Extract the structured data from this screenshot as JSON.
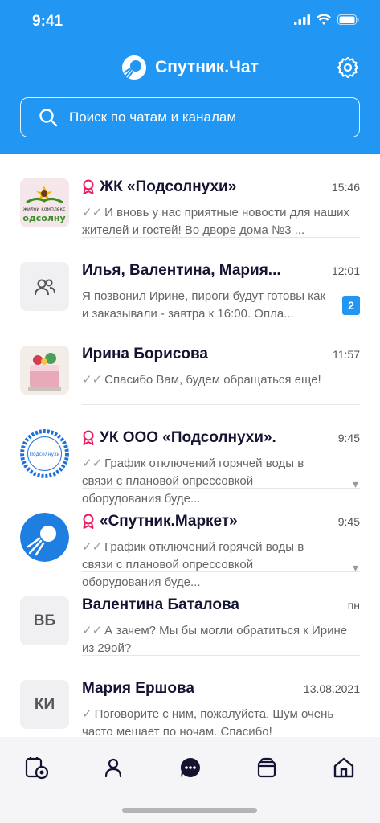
{
  "status": {
    "time": "9:41"
  },
  "header": {
    "title": "Спутник.Чат",
    "search_placeholder": "Поиск по чатам и каналам"
  },
  "chats": [
    {
      "name": "ЖК «Подсолнухи»",
      "time": "15:46",
      "message": "И вновь у нас приятные новости для наших жителей и гостей! Во дворе дома №3 ...",
      "pinned": true,
      "avatar_text": "жилой комплекс Подсолнухи"
    },
    {
      "name": "Илья, Валентина, Мария...",
      "time": "12:01",
      "message": "Я позвонил Ирине, пироги будут готовы как и заказывали - завтра к 16:00. Опла...",
      "unread": "2"
    },
    {
      "name": "Ирина Борисова",
      "time": "11:57",
      "message": "Спасибо Вам, будем обращаться еще!"
    },
    {
      "name": "УК ООО «Подсолнухи».",
      "time": "9:45",
      "message": "График отключений горячей воды в связи с плановой опрессовкой оборудования буде...",
      "pinned": true,
      "avatar_text": "Подсолнухи"
    },
    {
      "name": "«Спутник.Маркет»",
      "time": "9:45",
      "message": "График отключений горячей воды в связи с плановой опрессовкой оборудования буде...",
      "pinned": true
    },
    {
      "name": "Валентина Баталова",
      "time": "пн",
      "message": "А зачем? Мы бы могли обратиться к Ирине из 29ой?",
      "initials": "ВБ"
    },
    {
      "name": "Мария Ершова",
      "time": "13.08.2021",
      "message": "Поговорите с ним, пожалуйста. Шум очень часто мешает по ночам. Спасибо!",
      "initials": "КИ"
    }
  ],
  "colors": {
    "accent": "#2196f3",
    "pin": "#e91e63",
    "text": "#141432"
  },
  "tabbar": {
    "icons": [
      "services-icon",
      "profile-icon",
      "chat-icon",
      "wallet-icon",
      "home-icon"
    ],
    "active": "chat-icon"
  }
}
